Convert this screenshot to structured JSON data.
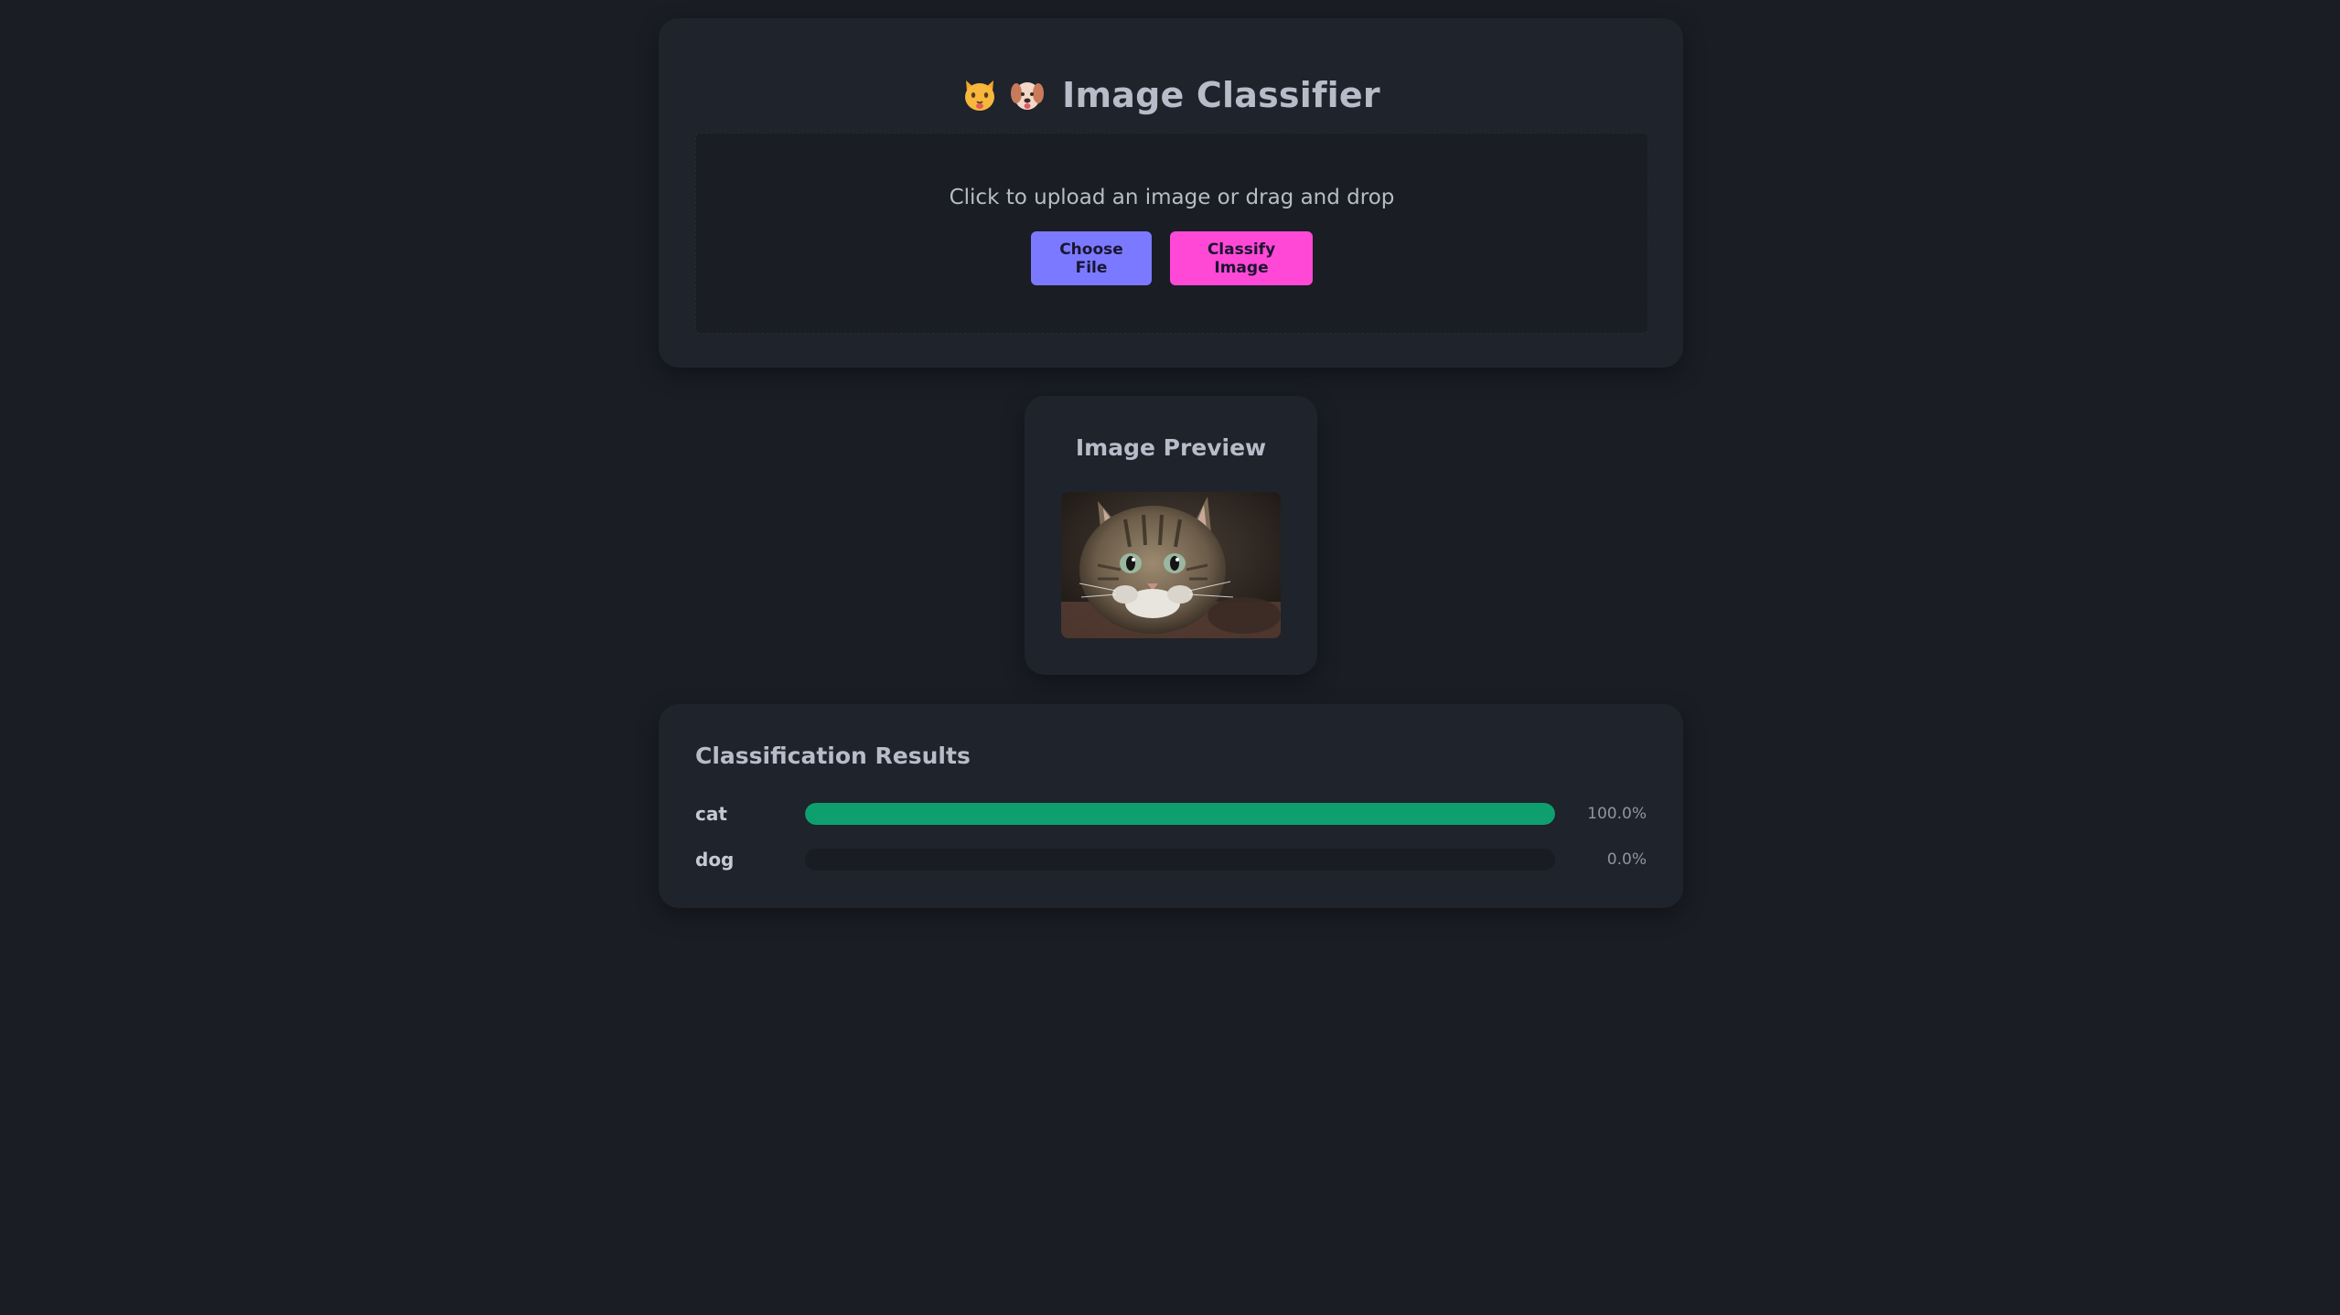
{
  "header": {
    "emoji_icons": [
      "cat-face-icon",
      "dog-face-icon"
    ],
    "title": "Image Classifier"
  },
  "upload": {
    "instruction": "Click to upload an image or drag and drop",
    "choose_label": "Choose File",
    "classify_label": "Classify Image"
  },
  "preview": {
    "title": "Image Preview",
    "image_subject": "cat-photo"
  },
  "results": {
    "title": "Classification Results",
    "items": [
      {
        "label": "cat",
        "percent_text": "100.0%",
        "fraction": 1.0
      },
      {
        "label": "dog",
        "percent_text": "0.0%",
        "fraction": 0.0
      }
    ]
  },
  "colors": {
    "background": "#1a1d24",
    "card": "#1f232b",
    "choose_button": "#7b79ff",
    "classify_button": "#ff49d6",
    "bar_fill": "#0e9f6e",
    "bar_track": "#191c22"
  }
}
